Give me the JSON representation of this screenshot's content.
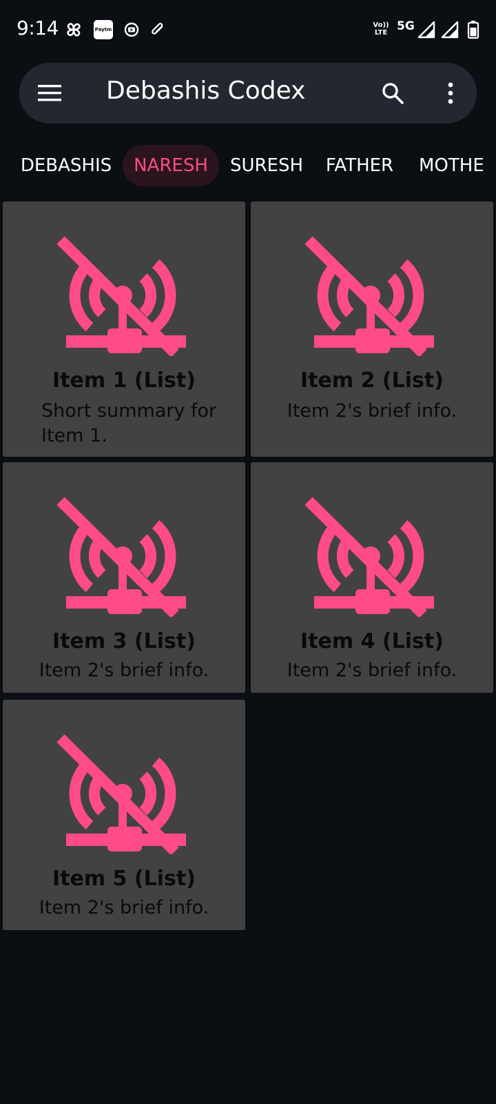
{
  "status_bar": {
    "time": "9:14",
    "paytm_label": "Paytm",
    "volte_top": "Vo))",
    "volte_bottom": "LTE",
    "network": "5G"
  },
  "app_bar": {
    "title": "Debashis Codex"
  },
  "tabs": [
    {
      "label": "DEBASHIS",
      "active": false
    },
    {
      "label": "NARESH",
      "active": true
    },
    {
      "label": "SURESH",
      "active": false
    },
    {
      "label": "FATHER",
      "active": false
    },
    {
      "label": "MOTHE",
      "active": false
    }
  ],
  "cards": [
    {
      "title": "Item 1 (List)",
      "description": "Short summary for Item 1.",
      "icon": "broken-image-icon"
    },
    {
      "title": "Item 2 (List)",
      "description": "Item 2's brief info.",
      "icon": "broken-image-icon"
    },
    {
      "title": "Item 3 (List)",
      "description": "Item 2's brief info.",
      "icon": "broken-image-icon"
    },
    {
      "title": "Item 4 (List)",
      "description": "Item 2's brief info.",
      "icon": "broken-image-icon"
    },
    {
      "title": "Item 5 (List)",
      "description": "Item 2's brief info.",
      "icon": "broken-image-icon"
    }
  ],
  "colors": {
    "background": "#0b0f14",
    "app_bar": "#232830",
    "card": "#424242",
    "accent": "#ff4b87",
    "active_tab_bg": "#2a151f"
  }
}
